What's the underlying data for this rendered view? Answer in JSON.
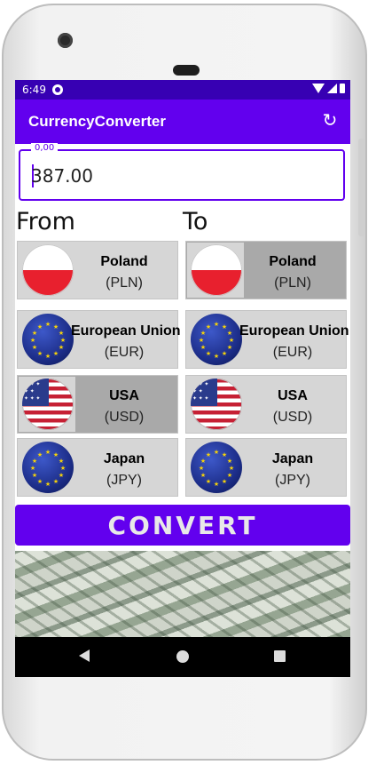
{
  "status_bar": {
    "time": "6:49"
  },
  "app_bar": {
    "title": "CurrencyConverter",
    "refresh_icon": "refresh-icon"
  },
  "amount_input": {
    "hint": "0,00",
    "value": "387.00"
  },
  "columns": {
    "from_label": "From",
    "to_label": "To"
  },
  "from_currencies": [
    {
      "name": "Poland",
      "code": "(PLN)",
      "flag": "flag-poland-icon",
      "selected": false
    },
    {
      "name": "European Union",
      "code": "(EUR)",
      "flag": "flag-eu-icon",
      "selected": false
    },
    {
      "name": "USA",
      "code": "(USD)",
      "flag": "flag-usa-icon",
      "selected": true
    },
    {
      "name": "Japan",
      "code": "(JPY)",
      "flag": "flag-eu-icon",
      "selected": false
    }
  ],
  "to_currencies": [
    {
      "name": "Poland",
      "code": "(PLN)",
      "flag": "flag-poland-icon",
      "selected": true
    },
    {
      "name": "European Union",
      "code": "(EUR)",
      "flag": "flag-eu-icon",
      "selected": false
    },
    {
      "name": "USA",
      "code": "(USD)",
      "flag": "flag-usa-icon",
      "selected": false
    },
    {
      "name": "Japan",
      "code": "(JPY)",
      "flag": "flag-eu-icon",
      "selected": false
    }
  ],
  "convert_button": {
    "label": "CONVERT"
  },
  "colors": {
    "primary": "#6200ee",
    "primary_dark": "#3700b3",
    "card": "#d6d6d6",
    "card_selected": "#a9a9a9"
  }
}
